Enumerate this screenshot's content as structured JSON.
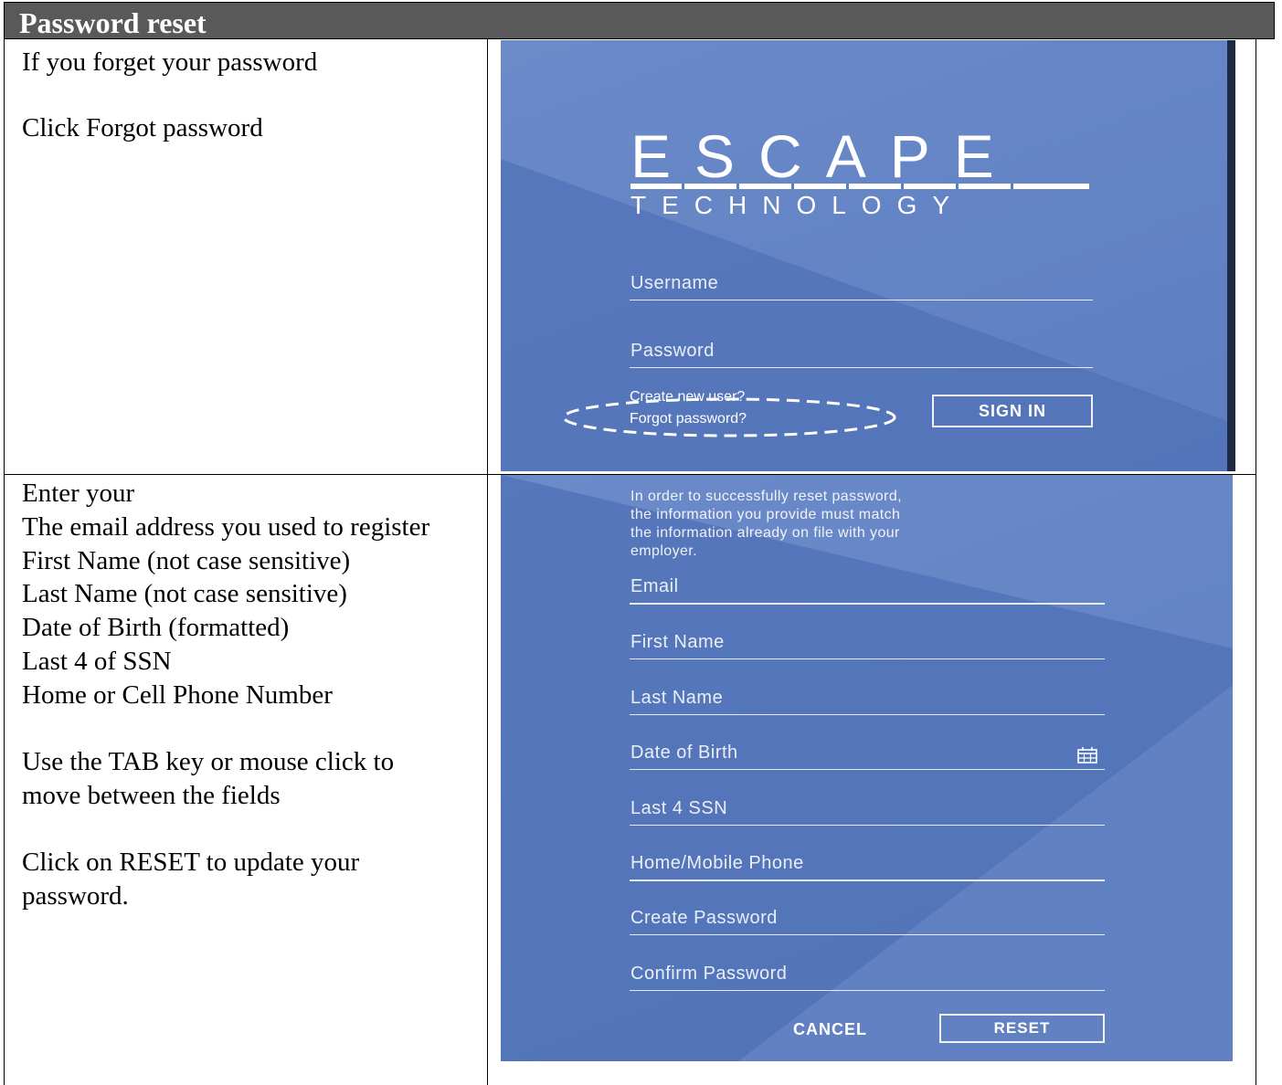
{
  "header": {
    "title": "Password reset"
  },
  "row1": {
    "instructions": [
      "If you forget your password",
      "Click Forgot password"
    ],
    "screen": {
      "logo_main": "ESCAPE",
      "logo_sub": "TECHNOLOGY",
      "username_placeholder": "Username",
      "password_placeholder": "Password",
      "create_user_link": "Create new user?",
      "forgot_password_link": "Forgot password?",
      "sign_in_label": "SIGN IN"
    }
  },
  "row2": {
    "instructions": [
      "Enter your",
      "The email address you used to register",
      "First Name (not case sensitive)",
      "Last Name (not case sensitive)",
      "Date of Birth (formatted)",
      "Last 4 of SSN",
      "Home or Cell Phone Number",
      "Use the TAB key or mouse click to",
      "move between the fields",
      "Click on RESET to update your",
      "password."
    ],
    "screen": {
      "notice": [
        "In order to successfully reset password,",
        "the information you provide must match",
        "the information already on file with your",
        "employer."
      ],
      "fields": {
        "email": "Email",
        "first_name": "First Name",
        "last_name": "Last Name",
        "dob": "Date of Birth",
        "ssn": "Last 4 SSN",
        "phone": "Home/Mobile Phone",
        "create_password": "Create Password",
        "confirm_password": "Confirm Password"
      },
      "dob_icon": "calendar-icon",
      "cancel_label": "CANCEL",
      "reset_label": "RESET"
    }
  },
  "colors": {
    "header_bg": "#595959",
    "screen_bg": "#5c7ec2",
    "highlight_ellipse": "#ffffff"
  }
}
